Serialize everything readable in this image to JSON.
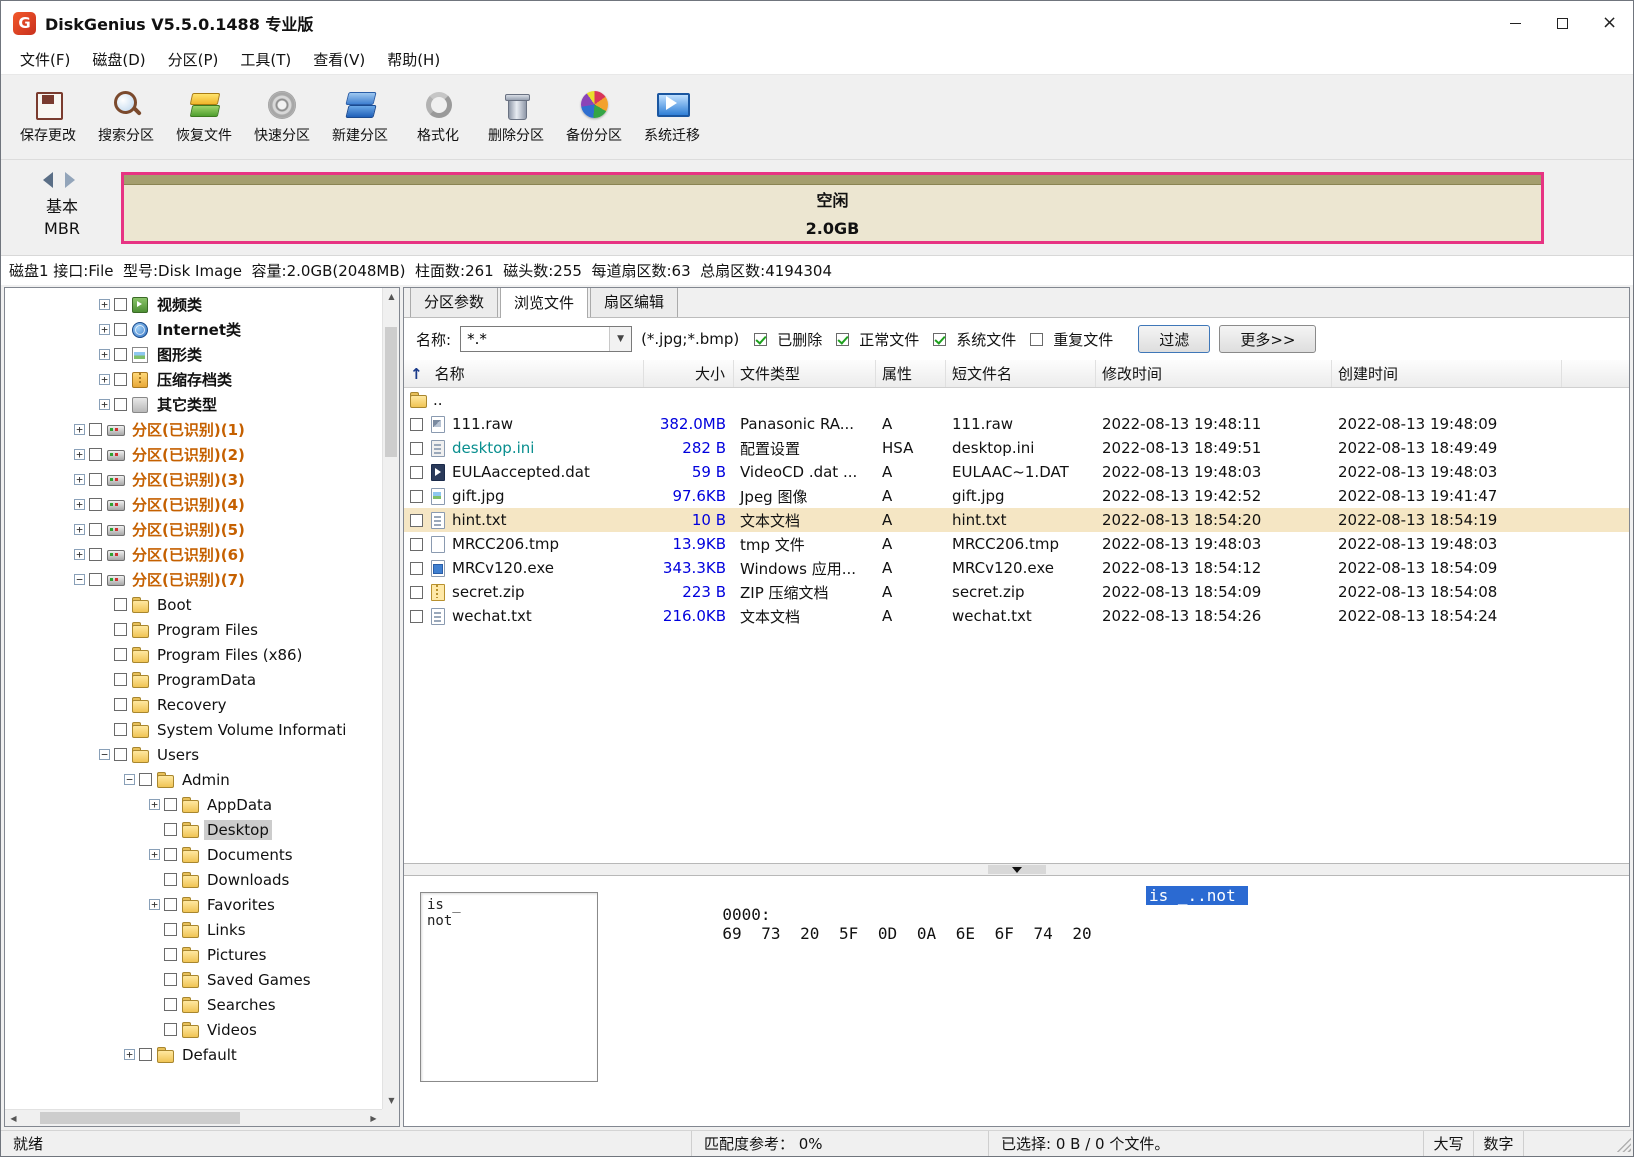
{
  "window": {
    "title": "DiskGenius V5.5.0.1488 专业版",
    "logo_letter": "G"
  },
  "menu": {
    "items": [
      {
        "label": "文件(F)"
      },
      {
        "label": "磁盘(D)"
      },
      {
        "label": "分区(P)"
      },
      {
        "label": "工具(T)"
      },
      {
        "label": "查看(V)"
      },
      {
        "label": "帮助(H)"
      }
    ]
  },
  "toolbar": {
    "buttons": [
      {
        "label": "保存更改",
        "icon": "save"
      },
      {
        "label": "搜索分区",
        "icon": "search"
      },
      {
        "label": "恢复文件",
        "icon": "recover"
      },
      {
        "label": "快速分区",
        "icon": "quick"
      },
      {
        "label": "新建分区",
        "icon": "newpart"
      },
      {
        "label": "格式化",
        "icon": "format"
      },
      {
        "label": "删除分区",
        "icon": "delete"
      },
      {
        "label": "备份分区",
        "icon": "backup"
      },
      {
        "label": "系统迁移",
        "icon": "migrate"
      }
    ]
  },
  "overview": {
    "disk_type_line1": "基本",
    "disk_type_line2": "MBR",
    "partition_name": "空闲",
    "partition_size": "2.0GB",
    "highlight_color": "#e73383"
  },
  "disk_info": "磁盘1 接口:File  型号:Disk Image  容量:2.0GB(2048MB)  柱面数:261  磁头数:255  每道扇区数:63  总扇区数:4194304",
  "tree": {
    "items": [
      {
        "label": "视频类",
        "level": 3,
        "exp": "+",
        "icon": "cat-video",
        "bold": true
      },
      {
        "label": "Internet类",
        "level": 3,
        "exp": "+",
        "icon": "cat-internet",
        "bold": true
      },
      {
        "label": "图形类",
        "level": 3,
        "exp": "+",
        "icon": "cat-graphics",
        "bold": true
      },
      {
        "label": "压缩存档类",
        "level": 3,
        "exp": "+",
        "icon": "cat-archive",
        "bold": true
      },
      {
        "label": "其它类型",
        "level": 3,
        "exp": "+",
        "icon": "cat-other",
        "bold": true
      },
      {
        "label": "分区(已识别)(1)",
        "level": 2,
        "exp": "+",
        "icon": "disk",
        "orange": true
      },
      {
        "label": "分区(已识别)(2)",
        "level": 2,
        "exp": "+",
        "icon": "disk",
        "orange": true
      },
      {
        "label": "分区(已识别)(3)",
        "level": 2,
        "exp": "+",
        "icon": "disk",
        "orange": true
      },
      {
        "label": "分区(已识别)(4)",
        "level": 2,
        "exp": "+",
        "icon": "disk",
        "orange": true
      },
      {
        "label": "分区(已识别)(5)",
        "level": 2,
        "exp": "+",
        "icon": "disk",
        "orange": true
      },
      {
        "label": "分区(已识别)(6)",
        "level": 2,
        "exp": "+",
        "icon": "disk",
        "orange": true
      },
      {
        "label": "分区(已识别)(7)",
        "level": 2,
        "exp": "−",
        "icon": "disk",
        "orange": true
      },
      {
        "label": "Boot",
        "level": 3,
        "icon": "folder"
      },
      {
        "label": "Program Files",
        "level": 3,
        "icon": "folder"
      },
      {
        "label": "Program Files (x86)",
        "level": 3,
        "icon": "folder"
      },
      {
        "label": "ProgramData",
        "level": 3,
        "icon": "folder"
      },
      {
        "label": "Recovery",
        "level": 3,
        "icon": "folder"
      },
      {
        "label": "System Volume Informati",
        "level": 3,
        "icon": "folder"
      },
      {
        "label": "Users",
        "level": 3,
        "exp": "−",
        "icon": "folder"
      },
      {
        "label": "Admin",
        "level": 4,
        "exp": "−",
        "icon": "folder"
      },
      {
        "label": "AppData",
        "level": 5,
        "exp": "+",
        "icon": "folder"
      },
      {
        "label": "Desktop",
        "level": 5,
        "icon": "folder",
        "selected": true
      },
      {
        "label": "Documents",
        "level": 5,
        "exp": "+",
        "icon": "folder"
      },
      {
        "label": "Downloads",
        "level": 5,
        "icon": "folder"
      },
      {
        "label": "Favorites",
        "level": 5,
        "exp": "+",
        "icon": "folder"
      },
      {
        "label": "Links",
        "level": 5,
        "icon": "folder"
      },
      {
        "label": "Pictures",
        "level": 5,
        "icon": "folder"
      },
      {
        "label": "Saved Games",
        "level": 5,
        "icon": "folder"
      },
      {
        "label": "Searches",
        "level": 5,
        "icon": "folder"
      },
      {
        "label": "Videos",
        "level": 5,
        "icon": "folder"
      },
      {
        "label": "Default",
        "level": 4,
        "exp": "+",
        "icon": "folder"
      }
    ]
  },
  "browser": {
    "tabs": [
      {
        "label": "分区参数"
      },
      {
        "label": "浏览文件",
        "active": true
      },
      {
        "label": "扇区编辑"
      }
    ],
    "filter": {
      "name_label": "名称:",
      "pattern": "*.*",
      "ext_hint": "(*.jpg;*.bmp)",
      "checks": [
        {
          "label": "已删除",
          "checked": true
        },
        {
          "label": "正常文件",
          "checked": true
        },
        {
          "label": "系统文件",
          "checked": true
        },
        {
          "label": "重复文件",
          "checked": false
        }
      ],
      "filter_button": "过滤",
      "more_button": "更多>>"
    },
    "table": {
      "sort_indicator": "↑",
      "columns": [
        "名称",
        "大小",
        "文件类型",
        "属性",
        "短文件名",
        "修改时间",
        "创建时间"
      ],
      "rows": [
        {
          "name": "..",
          "icon": "folder",
          "updir": true,
          "size": "",
          "type": "",
          "attr": "",
          "short": "",
          "mtime": "",
          "ctime": ""
        },
        {
          "name": "111.raw",
          "icon": "f-raw",
          "size": "382.0MB",
          "type": "Panasonic RA...",
          "attr": "A",
          "short": "111.raw",
          "mtime": "2022-08-13 19:48:11",
          "ctime": "2022-08-13 19:48:09"
        },
        {
          "name": "desktop.ini",
          "icon": "f-ini",
          "deleted": true,
          "size": "282 B",
          "type": "配置设置",
          "attr": "HSA",
          "short": "desktop.ini",
          "mtime": "2022-08-13 18:49:51",
          "ctime": "2022-08-13 18:49:49"
        },
        {
          "name": "EULAaccepted.dat",
          "icon": "f-dat",
          "size": "59 B",
          "type": "VideoCD .dat ...",
          "attr": "A",
          "short": "EULAAC~1.DAT",
          "mtime": "2022-08-13 19:48:03",
          "ctime": "2022-08-13 19:48:03"
        },
        {
          "name": "gift.jpg",
          "icon": "f-jpg",
          "size": "97.6KB",
          "type": "Jpeg 图像",
          "attr": "A",
          "short": "gift.jpg",
          "mtime": "2022-08-13 19:42:52",
          "ctime": "2022-08-13 19:41:47"
        },
        {
          "name": "hint.txt",
          "icon": "f-txt",
          "selected": true,
          "size": "10 B",
          "type": "文本文档",
          "attr": "A",
          "short": "hint.txt",
          "mtime": "2022-08-13 18:54:20",
          "ctime": "2022-08-13 18:54:19"
        },
        {
          "name": "MRCC206.tmp",
          "icon": "f-tmp",
          "size": "13.9KB",
          "type": "tmp 文件",
          "attr": "A",
          "short": "MRCC206.tmp",
          "mtime": "2022-08-13 19:48:03",
          "ctime": "2022-08-13 19:48:03"
        },
        {
          "name": "MRCv120.exe",
          "icon": "f-exe",
          "size": "343.3KB",
          "type": "Windows 应用...",
          "attr": "A",
          "short": "MRCv120.exe",
          "mtime": "2022-08-13 18:54:12",
          "ctime": "2022-08-13 18:54:09"
        },
        {
          "name": "secret.zip",
          "icon": "f-zip",
          "size": "223 B",
          "type": "ZIP 压缩文档",
          "attr": "A",
          "short": "secret.zip",
          "mtime": "2022-08-13 18:54:09",
          "ctime": "2022-08-13 18:54:08"
        },
        {
          "name": "wechat.txt",
          "icon": "f-txt",
          "size": "216.0KB",
          "type": "文本文档",
          "attr": "A",
          "short": "wechat.txt",
          "mtime": "2022-08-13 18:54:26",
          "ctime": "2022-08-13 18:54:24"
        }
      ]
    },
    "preview": {
      "text": "is _\nnot",
      "hex_offset": "0000:",
      "hex_bytes": "69 73 20 5F 0D 0A 6E 6F 74 20",
      "hex_ascii": "is _..not "
    }
  },
  "statusbar": {
    "ready": "就绪",
    "match": "匹配度参考： 0%",
    "selection": "已选择: 0 B / 0 个文件。",
    "caps": "大写",
    "num": "数字"
  }
}
